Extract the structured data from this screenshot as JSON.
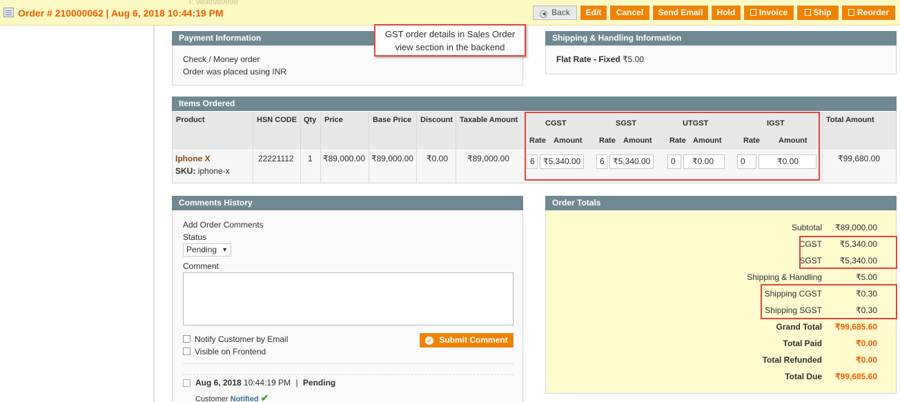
{
  "header": {
    "order_title": "Order # 210000062 | Aug 6, 2018 10:44:19 PM",
    "ghost_phone": "T: 9898989898",
    "buttons": {
      "back": "Back",
      "edit": "Edit",
      "cancel": "Cancel",
      "send_email": "Send Email",
      "hold": "Hold",
      "invoice": "Invoice",
      "ship": "Ship",
      "reorder": "Reorder"
    }
  },
  "callout": {
    "line1": "GST order details in Sales Order",
    "line2": "view section in the backend"
  },
  "payment": {
    "title": "Payment Information",
    "method": "Check / Money order",
    "currency_note": "Order was placed using INR"
  },
  "shipping": {
    "title": "Shipping & Handling Information",
    "method_bold": "Flat Rate - Fixed",
    "amount": "₹5.00"
  },
  "items": {
    "title": "Items Ordered",
    "headers": {
      "product": "Product",
      "hsn": "HSN CODE",
      "qty": "Qty",
      "price": "Price",
      "base_price": "Base Price",
      "discount": "Discount",
      "taxable": "Taxable Amount",
      "cgst": "CGST",
      "sgst": "SGST",
      "utgst": "UTGST",
      "igst": "IGST",
      "rate": "Rate",
      "amount": "Amount",
      "total": "Total Amount"
    },
    "row": {
      "name": "Iphone X",
      "sku_label": "SKU:",
      "sku": "iphone-x",
      "hsn": "22221112",
      "qty": "1",
      "price": "₹89,000.00",
      "base_price": "₹89,000.00",
      "discount": "₹0.00",
      "taxable": "₹89,000.00",
      "cgst_rate": "6",
      "cgst_amount": "₹5,340.00",
      "sgst_rate": "6",
      "sgst_amount": "₹5,340.00",
      "utgst_rate": "0",
      "utgst_amount": "₹0.00",
      "igst_rate": "0",
      "igst_amount": "₹0.00",
      "total": "₹99,680.00"
    }
  },
  "comments": {
    "title": "Comments History",
    "add_label": "Add Order Comments",
    "status_label": "Status",
    "status_value": "Pending",
    "comment_label": "Comment",
    "notify_label": "Notify Customer by Email",
    "visible_label": "Visible on Frontend",
    "submit": "Submit Comment",
    "history_date": "Aug 6, 2018",
    "history_time": "10:44:19 PM",
    "history_sep": "|",
    "history_status": "Pending",
    "customer_label": "Customer",
    "notified_label": "Notified"
  },
  "totals": {
    "title": "Order Totals",
    "rows": [
      {
        "label": "Subtotal",
        "value": "₹89,000.00"
      },
      {
        "label": "CGST",
        "value": "₹5,340.00"
      },
      {
        "label": "SGST",
        "value": "₹5,340.00"
      },
      {
        "label": "Shipping & Handling",
        "value": "₹5.00"
      },
      {
        "label": "Shipping CGST",
        "value": "₹0.30"
      },
      {
        "label": "Shipping SGST",
        "value": "₹0.30"
      },
      {
        "label": "Grand Total",
        "value": "₹99,685.60"
      },
      {
        "label": "Total Paid",
        "value": "₹0.00"
      },
      {
        "label": "Total Refunded",
        "value": "₹0.00"
      },
      {
        "label": "Total Due",
        "value": "₹99,685.60"
      }
    ]
  },
  "colors": {
    "accent": "#eb5e00",
    "button": "#f18200",
    "section_header": "#6f8992",
    "highlight": "#e0443a",
    "totals_bg": "#fefbcf"
  }
}
